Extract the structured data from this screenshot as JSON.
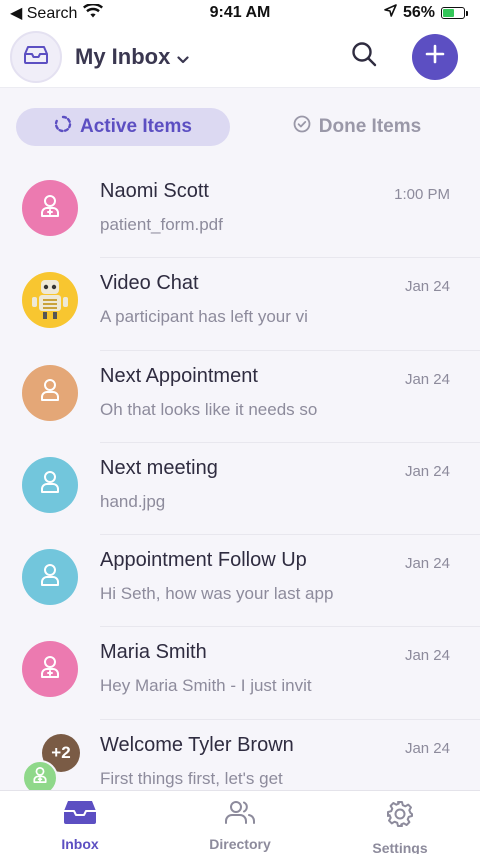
{
  "status_bar": {
    "back_label": "◀ Search",
    "time": "9:41 AM",
    "battery_text": "56%",
    "battery_level": 0.56
  },
  "header": {
    "title": "My Inbox",
    "logo_icon": "inbox-tray-icon",
    "search_icon": "search-icon",
    "add_icon": "plus-icon",
    "accent_color": "#5c4fc2"
  },
  "tabs": [
    {
      "label": "Active Items",
      "icon": "spinner-icon",
      "active": true
    },
    {
      "label": "Done Items",
      "icon": "check-circle-icon",
      "active": false
    }
  ],
  "inbox": {
    "items": [
      {
        "title": "Naomi Scott",
        "preview": "patient_form.pdf",
        "date": "1:00 PM",
        "avatar_color": "#ec7ab0",
        "avatar_icon": "user-plus-icon"
      },
      {
        "title": "Video Chat",
        "preview": "A participant has left your vi",
        "date": "Jan 24",
        "avatar_color": "#f8c630",
        "avatar_icon": "robot-icon"
      },
      {
        "title": "Next Appointment",
        "preview": "Oh that looks like it needs so",
        "date": "Jan 24",
        "avatar_color": "#e4a777",
        "avatar_icon": "user-icon"
      },
      {
        "title": "Next meeting",
        "preview": "hand.jpg",
        "date": "Jan 24",
        "avatar_color": "#72c6dc",
        "avatar_icon": "user-icon"
      },
      {
        "title": "Appointment Follow Up",
        "preview": "Hi Seth, how was your last app",
        "date": "Jan 24",
        "avatar_color": "#72c6dc",
        "avatar_icon": "user-icon"
      },
      {
        "title": "Maria Smith",
        "preview": "Hey Maria Smith - I just invit",
        "date": "Jan 24",
        "avatar_color": "#ec7ab0",
        "avatar_icon": "user-plus-icon"
      },
      {
        "title": "Welcome Tyler Brown",
        "preview": "First things first, let's get",
        "date": "Jan 24",
        "group_count": "+2",
        "avatar_color": "#8fd88a",
        "avatar_icon": "user-plus-icon"
      }
    ]
  },
  "bottom_nav": [
    {
      "label": "Inbox",
      "icon": "inbox-icon",
      "active": true
    },
    {
      "label": "Directory",
      "icon": "people-icon",
      "active": false
    },
    {
      "label": "Settings",
      "icon": "gear-icon",
      "active": false
    }
  ]
}
